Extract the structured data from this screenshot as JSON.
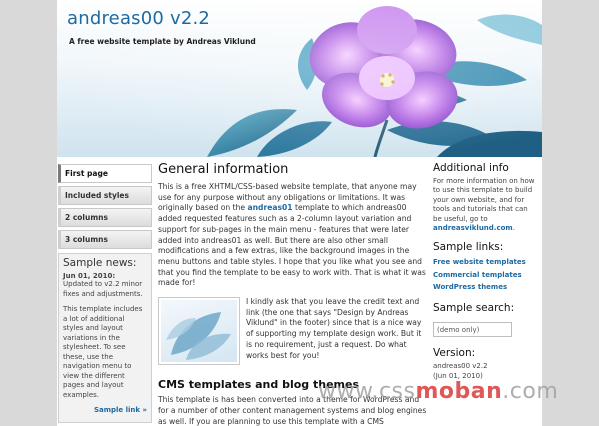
{
  "header": {
    "title": "andreas00 v2.2",
    "slogan": "A free website template by Andreas Viklund"
  },
  "nav": {
    "items": [
      {
        "label": "First page"
      },
      {
        "label": "Included styles"
      },
      {
        "label": "2 columns"
      },
      {
        "label": "3 columns"
      }
    ]
  },
  "news": {
    "title": "Sample news:",
    "date": "Jun 01, 2010:",
    "p1": "Updated to v2.2 minor fixes and adjustments.",
    "p2": "This template includes a lot of additional styles and layout variations in the stylesheet. To see these, use the navigation menu to view the different pages and layout examples.",
    "link": "Sample link »"
  },
  "main": {
    "title": "General information",
    "p1_a": "This is a free XHTML/CSS-based website template, that anyone may use for any purpose without any obligations or limitations. It was originally based on the ",
    "p1_link": "andreas01",
    "p1_b": " template to which andreas00 added requested features such as a 2-column layout variation and support for sub-pages in the main menu - features that were later added into andreas01 as well. But there are also other small modifications and a few extras, like the background images in the menu buttons and table styles. I hope that you like what you see and that you find the template to be easy to work with. That is what it was made for!",
    "p2": "I kindly ask that you leave the credit text and link (the one that says \"Design by Andreas Viklund\" in the footer) since that is a nice way of supporting my template design work. But it is no requirement, just a request. Do what works best for you!",
    "cms_title": "CMS templates and blog themes",
    "p3": "This template is has been converted into a theme for WordPress and for a number of other content management systems and blog engines as well. If you are planning to use this template with a CMS"
  },
  "right": {
    "additional_title": "Additional info",
    "additional_text": "For more information on how to use this template to build your own website, and for tools and tutorials that can be useful, go to ",
    "additional_link": "andreasviklund.com",
    "additional_end": ".",
    "links_title": "Sample links:",
    "links": [
      {
        "label": "Free website templates"
      },
      {
        "label": "Commercial templates"
      },
      {
        "label": "WordPress themes"
      }
    ],
    "search_title": "Sample search:",
    "search_value": "(demo only)",
    "version_title": "Version:",
    "version_line1": "andreas00 v2.2",
    "version_line2": "(Jun 01, 2010)"
  },
  "watermark": {
    "prefix": "www.css",
    "accent": "moban",
    "suffix": ".com"
  },
  "colors": {
    "link_blue": "#1d6aa3",
    "page_bg": "#d9d9d9",
    "flower": "#b46be0"
  }
}
